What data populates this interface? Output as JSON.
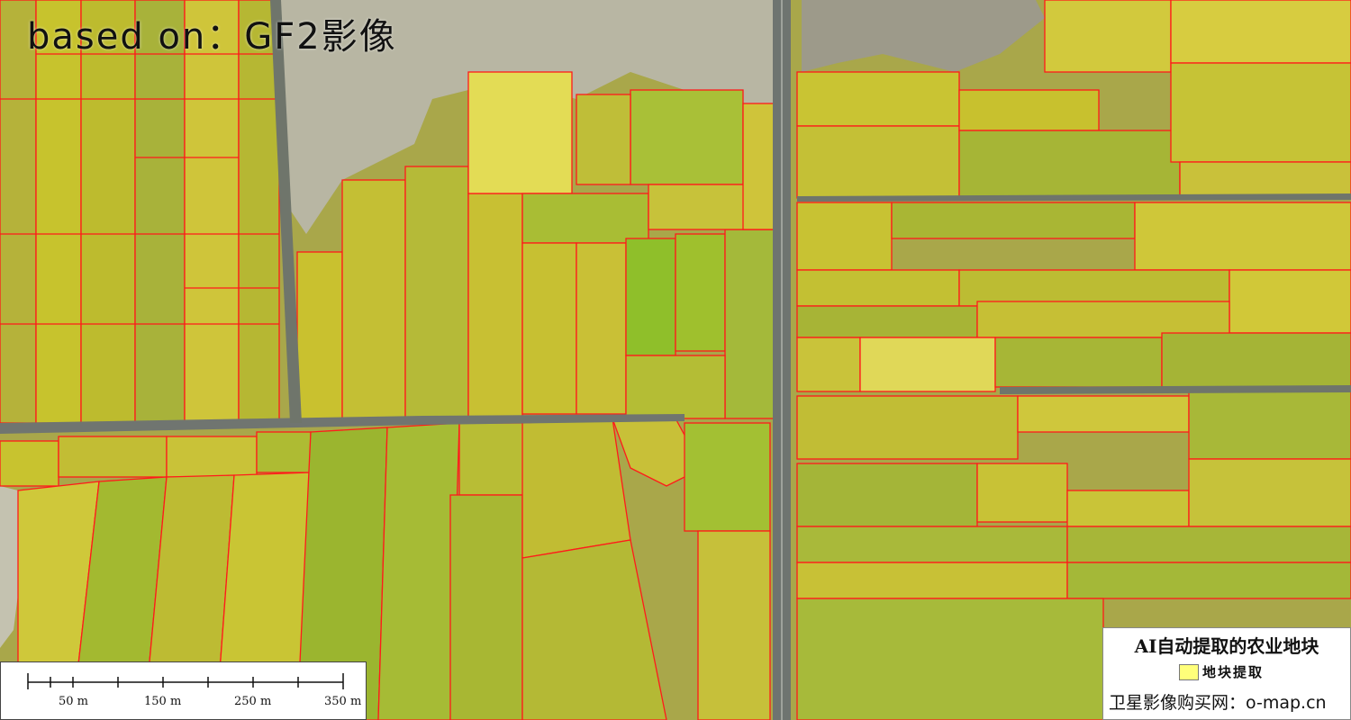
{
  "title": "based on：GF2影像",
  "colors": {
    "field_fill": "#c9c427",
    "field_fill_green": "#9fbd2a",
    "parcel_outline": "#ff0000",
    "road": "#6f7470",
    "bare_ground": "#b3b29c"
  },
  "scale_bar": {
    "labels": [
      "50 m",
      "150 m",
      "250 m",
      "350 m"
    ]
  },
  "legend": {
    "title": "AI自动提取的农业地块",
    "item_label": "地块提取",
    "source": "卫星影像购买网：o-map.cn"
  }
}
